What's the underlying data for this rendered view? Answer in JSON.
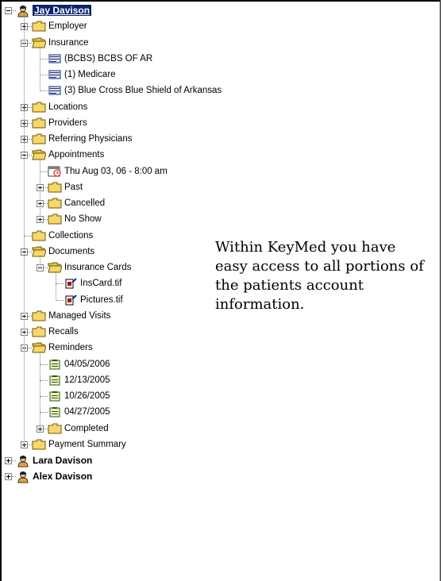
{
  "tree": {
    "patients": [
      {
        "name": "Jay Davison",
        "expanded": true,
        "selected": true,
        "children": [
          {
            "label": "Employer",
            "icon": "folder-closed-icon",
            "expander": "plus"
          },
          {
            "label": "Insurance",
            "icon": "folder-open-icon",
            "expander": "minus",
            "children": [
              {
                "label": "(BCBS) BCBS OF AR",
                "icon": "insurance-card-icon"
              },
              {
                "label": "(1) Medicare",
                "icon": "insurance-card-icon"
              },
              {
                "label": "(3) Blue Cross Blue Shield of Arkansas",
                "icon": "insurance-card-icon"
              }
            ]
          },
          {
            "label": "Locations",
            "icon": "folder-closed-icon",
            "expander": "plus"
          },
          {
            "label": "Providers",
            "icon": "folder-closed-icon",
            "expander": "plus"
          },
          {
            "label": "Referring Physicians",
            "icon": "folder-closed-icon",
            "expander": "plus"
          },
          {
            "label": "Appointments",
            "icon": "folder-open-icon",
            "expander": "minus",
            "children": [
              {
                "label": "Thu Aug 03, 06 - 8:00 am",
                "icon": "calendar-clock-icon"
              },
              {
                "label": "Past",
                "icon": "folder-closed-icon",
                "expander": "plus"
              },
              {
                "label": "Cancelled",
                "icon": "folder-closed-icon",
                "expander": "plus"
              },
              {
                "label": "No Show",
                "icon": "folder-closed-icon",
                "expander": "plus"
              }
            ]
          },
          {
            "label": "Collections",
            "icon": "folder-closed-icon"
          },
          {
            "label": "Documents",
            "icon": "folder-open-icon",
            "expander": "minus",
            "children": [
              {
                "label": "Insurance Cards",
                "icon": "folder-open-icon",
                "expander": "minus",
                "children": [
                  {
                    "label": "InsCard.tif",
                    "icon": "image-file-icon"
                  },
                  {
                    "label": "Pictures.tif",
                    "icon": "image-file-icon"
                  }
                ]
              }
            ]
          },
          {
            "label": "Managed Visits",
            "icon": "folder-closed-icon",
            "expander": "plus"
          },
          {
            "label": "Recalls",
            "icon": "folder-closed-icon",
            "expander": "plus"
          },
          {
            "label": "Reminders",
            "icon": "folder-open-icon",
            "expander": "minus",
            "children": [
              {
                "label": "04/05/2006",
                "icon": "reminder-note-icon"
              },
              {
                "label": "12/13/2005",
                "icon": "reminder-note-icon"
              },
              {
                "label": "10/26/2005",
                "icon": "reminder-note-icon"
              },
              {
                "label": "04/27/2005",
                "icon": "reminder-note-icon"
              },
              {
                "label": "Completed",
                "icon": "folder-closed-icon",
                "expander": "plus"
              }
            ]
          },
          {
            "label": "Payment Summary",
            "icon": "folder-closed-icon",
            "expander": "plus"
          }
        ]
      },
      {
        "name": "Lara Davison",
        "expanded": false
      },
      {
        "name": "Alex Davison",
        "expanded": false
      }
    ]
  },
  "callout": {
    "text": "Within KeyMed you have easy access to all portions of the patients account information."
  },
  "colors": {
    "selection": "#0a246a",
    "folder": "#f5d76e",
    "tree_lines": "#808080"
  }
}
